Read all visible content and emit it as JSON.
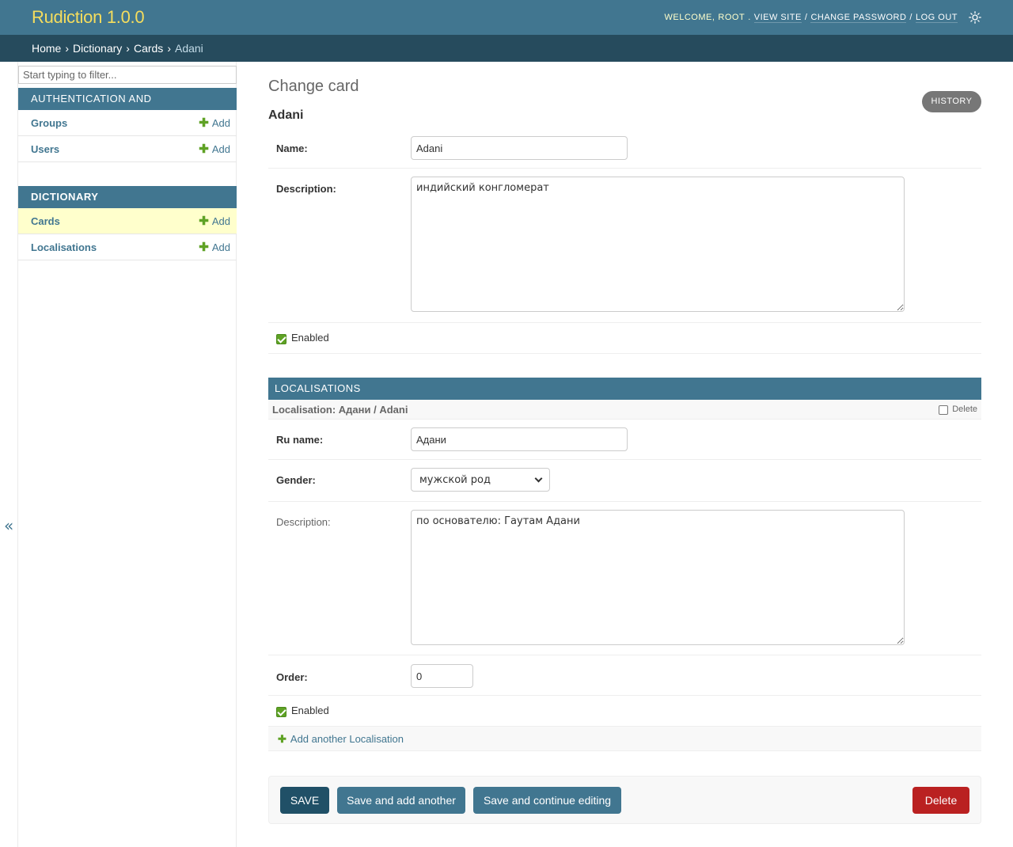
{
  "header": {
    "brand": "Rudiction 1.0.0",
    "welcome": "Welcome,",
    "username": "root",
    "view_site": "View site",
    "change_password": "Change password",
    "log_out": "Log out",
    "separator": "/"
  },
  "breadcrumbs": {
    "home": "Home",
    "app": "Dictionary",
    "model": "Cards",
    "current": "Adani",
    "separator": "›"
  },
  "sidebar": {
    "filter_placeholder": "Start typing to filter...",
    "toggle": "«",
    "modules": [
      {
        "caption": "Authentication and Authorization",
        "models": [
          {
            "name": "Groups",
            "add_label": "Add"
          },
          {
            "name": "Users",
            "add_label": "Add"
          }
        ]
      },
      {
        "caption": "Dictionary",
        "models": [
          {
            "name": "Cards",
            "add_label": "Add",
            "selected": true
          },
          {
            "name": "Localisations",
            "add_label": "Add"
          }
        ]
      }
    ]
  },
  "content": {
    "page_title": "Change card",
    "object_title": "Adani",
    "history_label": "History",
    "fields": {
      "name_label": "Name:",
      "name_value": "Adani",
      "description_label": "Description:",
      "description_value": "индийский конгломерат",
      "enabled_label": "Enabled"
    },
    "inline": {
      "header": "Localisations",
      "subheader": "Localisation: Адани / Adani",
      "delete_label": "Delete",
      "ru_name_label": "Ru name:",
      "ru_name_value": "Адани",
      "gender_label": "Gender:",
      "gender_value": "мужской род",
      "description_label": "Description:",
      "description_value": "по основателю: Гаутам Адани",
      "order_label": "Order:",
      "order_value": "0",
      "enabled_label": "Enabled",
      "add_another": "Add another Localisation"
    },
    "submit": {
      "save": "Save",
      "save_add": "Save and add another",
      "save_continue": "Save and continue editing",
      "delete": "Delete"
    }
  },
  "colors": {
    "primary": "#417690",
    "header_bg": "#417690",
    "breadcrumbs_bg": "#264b5d",
    "brand": "#f5dd5d",
    "selected_row": "#ffffcc",
    "add_green": "#5fa225",
    "delete_red": "#ba2121",
    "save_dark": "#205067"
  }
}
